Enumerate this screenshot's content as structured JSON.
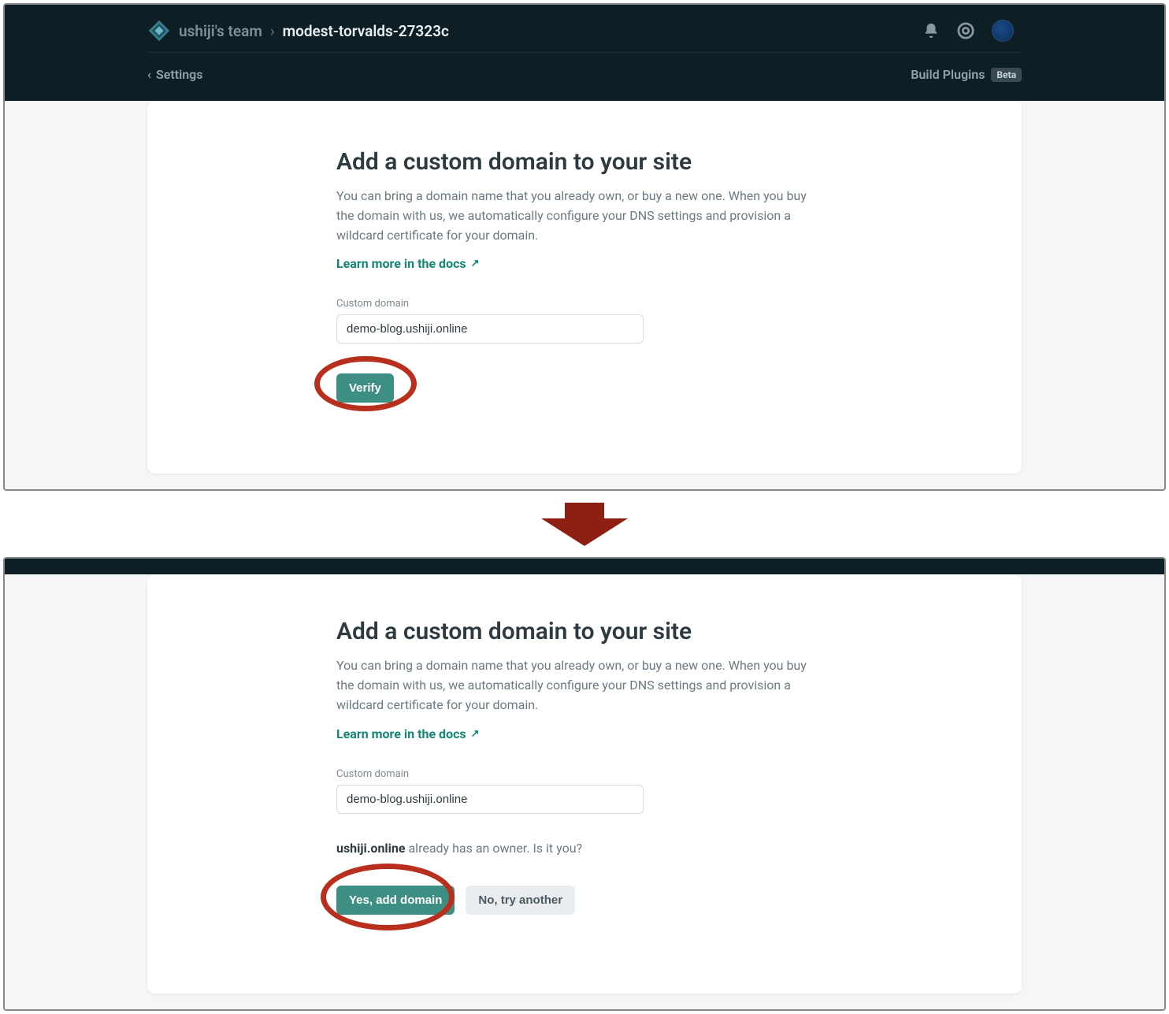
{
  "header": {
    "team_label": "ushiji's team",
    "separator": "›",
    "site_name": "modest-torvalds-27323c"
  },
  "subnav": {
    "back_label": "Settings",
    "build_plugins_label": "Build Plugins",
    "beta_badge": "Beta"
  },
  "panel": {
    "title": "Add a custom domain to your site",
    "description": "You can bring a domain name that you already own, or buy a new one. When you buy the domain with us, we automatically configure your DNS settings and provision a wildcard certificate for your domain.",
    "docs_link": "Learn more in the docs",
    "external_arrow": "↗",
    "input_label": "Custom domain",
    "input_value": "demo-blog.ushiji.online"
  },
  "step_a": {
    "verify_button": "Verify"
  },
  "step_b": {
    "owner_domain": "ushiji.online",
    "owner_suffix": " already has an owner. Is it you?",
    "yes_button": "Yes, add domain",
    "no_button": "No, try another"
  }
}
